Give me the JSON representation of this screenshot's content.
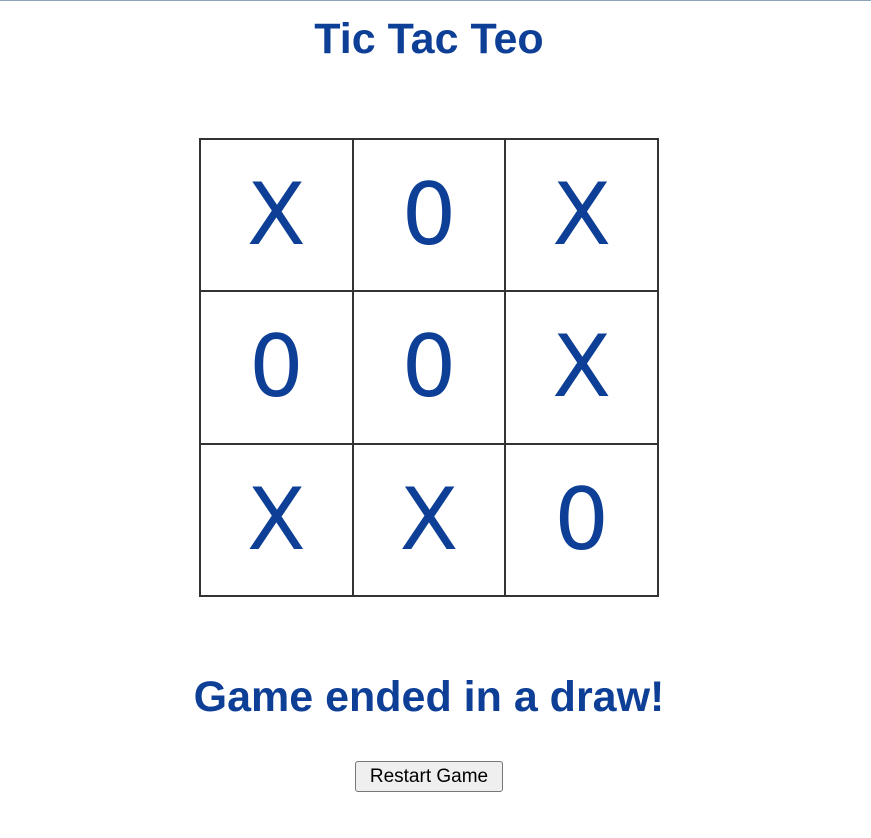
{
  "page": {
    "title": "Tic Tac Teo",
    "status_message": "Game ended in a draw!"
  },
  "board": {
    "cells": [
      "X",
      "0",
      "X",
      "0",
      "0",
      "X",
      "X",
      "X",
      "0"
    ]
  },
  "controls": {
    "restart_label": "Restart Game"
  },
  "colors": {
    "accent": "#0e3f96",
    "grid_line": "#333333",
    "background": "#ffffff"
  }
}
